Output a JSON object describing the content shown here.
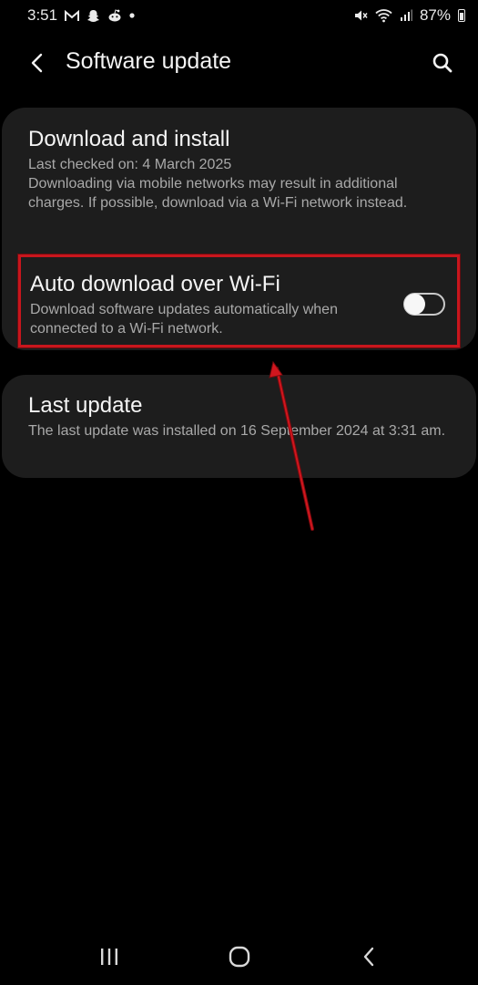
{
  "status_bar": {
    "time": "3:51",
    "battery": "87%",
    "left_icons": [
      "gmail-icon",
      "snapchat-icon",
      "reddit-icon",
      "dot-icon"
    ],
    "right_icons": [
      "mute-icon",
      "wifi-icon",
      "signal-icon",
      "battery-icon"
    ]
  },
  "app_bar": {
    "title": "Software update",
    "back_icon": "back-arrow-icon",
    "search_icon": "search-icon"
  },
  "download_install": {
    "title": "Download and install",
    "last_checked": "Last checked on: 4 March 2025",
    "description": "Downloading via mobile networks may result in additional charges. If possible, download via a Wi-Fi network instead."
  },
  "auto_download": {
    "title": "Auto download over Wi-Fi",
    "description": "Download software updates automatically when connected to a Wi-Fi network.",
    "enabled": false
  },
  "last_update": {
    "title": "Last update",
    "description": "The last update was installed on 16 September 2024 at 3:31 am."
  },
  "nav_bar": {
    "recents_icon": "recents-icon",
    "home_icon": "home-icon",
    "back_icon": "nav-back-icon"
  },
  "colors": {
    "background": "#000000",
    "card": "#1d1d1d",
    "highlight": "#c8161d"
  }
}
